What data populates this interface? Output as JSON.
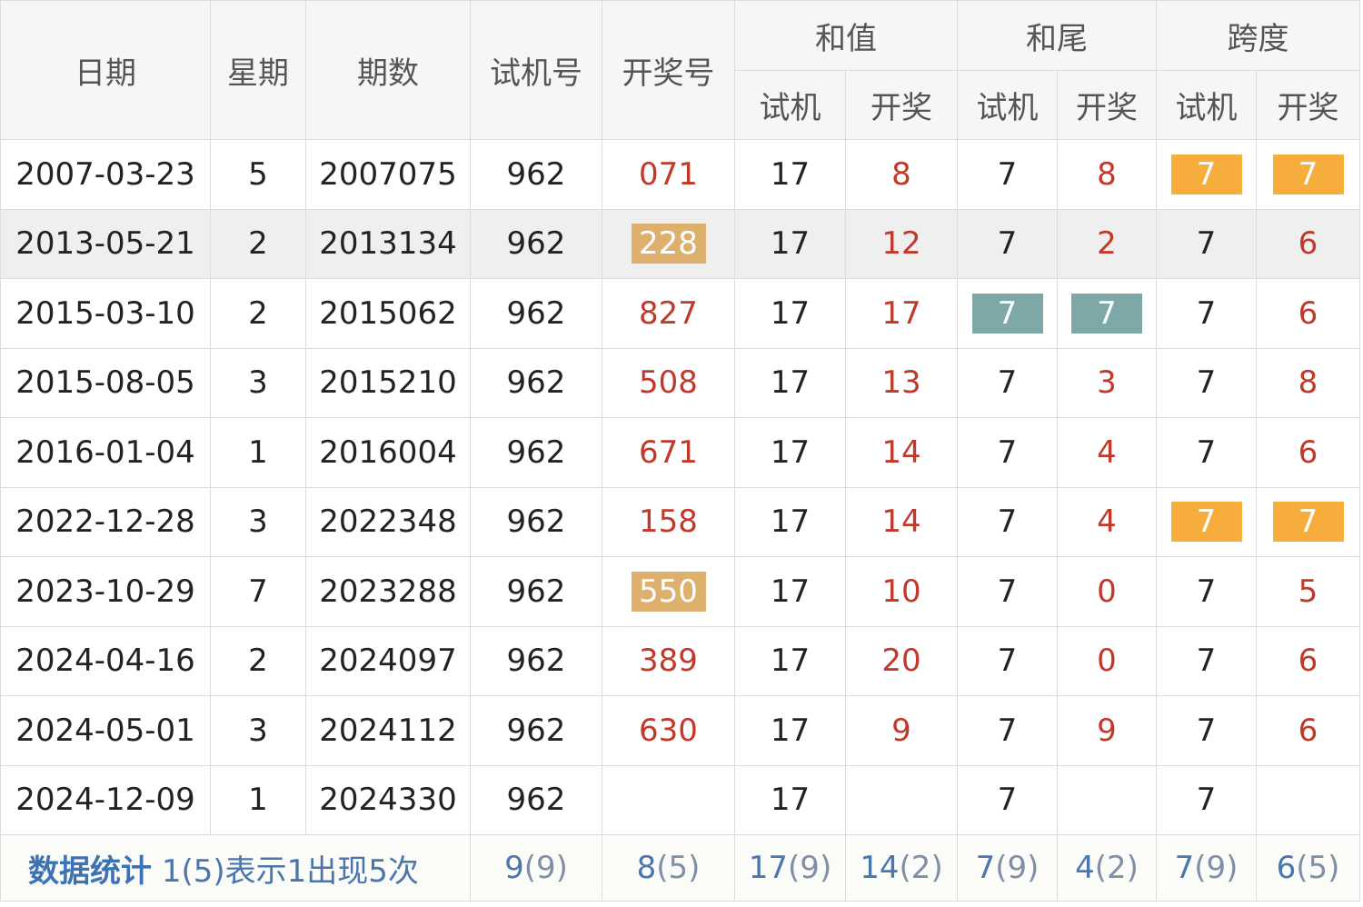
{
  "header": {
    "date": "日期",
    "weekday": "星期",
    "issue": "期数",
    "test_number": "试机号",
    "draw_number": "开奖号",
    "sum_group": "和值",
    "tail_group": "和尾",
    "span_group": "跨度",
    "sub_test": "试机",
    "sub_draw": "开奖"
  },
  "rows": [
    {
      "date": "2007-03-23",
      "weekday": "5",
      "issue": "2007075",
      "test": "962",
      "draw": "071",
      "sum_test": "17",
      "sum_draw": "8",
      "tail_test": "7",
      "tail_draw": "8",
      "span_test": "7",
      "span_draw": "7"
    },
    {
      "date": "2013-05-21",
      "weekday": "2",
      "issue": "2013134",
      "test": "962",
      "draw": "228",
      "sum_test": "17",
      "sum_draw": "12",
      "tail_test": "7",
      "tail_draw": "2",
      "span_test": "7",
      "span_draw": "6"
    },
    {
      "date": "2015-03-10",
      "weekday": "2",
      "issue": "2015062",
      "test": "962",
      "draw": "827",
      "sum_test": "17",
      "sum_draw": "17",
      "tail_test": "7",
      "tail_draw": "7",
      "span_test": "7",
      "span_draw": "6"
    },
    {
      "date": "2015-08-05",
      "weekday": "3",
      "issue": "2015210",
      "test": "962",
      "draw": "508",
      "sum_test": "17",
      "sum_draw": "13",
      "tail_test": "7",
      "tail_draw": "3",
      "span_test": "7",
      "span_draw": "8"
    },
    {
      "date": "2016-01-04",
      "weekday": "1",
      "issue": "2016004",
      "test": "962",
      "draw": "671",
      "sum_test": "17",
      "sum_draw": "14",
      "tail_test": "7",
      "tail_draw": "4",
      "span_test": "7",
      "span_draw": "6"
    },
    {
      "date": "2022-12-28",
      "weekday": "3",
      "issue": "2022348",
      "test": "962",
      "draw": "158",
      "sum_test": "17",
      "sum_draw": "14",
      "tail_test": "7",
      "tail_draw": "4",
      "span_test": "7",
      "span_draw": "7"
    },
    {
      "date": "2023-10-29",
      "weekday": "7",
      "issue": "2023288",
      "test": "962",
      "draw": "550",
      "sum_test": "17",
      "sum_draw": "10",
      "tail_test": "7",
      "tail_draw": "0",
      "span_test": "7",
      "span_draw": "5"
    },
    {
      "date": "2024-04-16",
      "weekday": "2",
      "issue": "2024097",
      "test": "962",
      "draw": "389",
      "sum_test": "17",
      "sum_draw": "20",
      "tail_test": "7",
      "tail_draw": "0",
      "span_test": "7",
      "span_draw": "6"
    },
    {
      "date": "2024-05-01",
      "weekday": "3",
      "issue": "2024112",
      "test": "962",
      "draw": "630",
      "sum_test": "17",
      "sum_draw": "9",
      "tail_test": "7",
      "tail_draw": "9",
      "span_test": "7",
      "span_draw": "6"
    },
    {
      "date": "2024-12-09",
      "weekday": "1",
      "issue": "2024330",
      "test": "962",
      "draw": "",
      "sum_test": "17",
      "sum_draw": "",
      "tail_test": "7",
      "tail_draw": "",
      "span_test": "7",
      "span_draw": ""
    }
  ],
  "footer": {
    "title": "数据统计",
    "desc": "1(5)表示1出现5次",
    "test_num": "9",
    "test_cnt": "(9)",
    "draw_num": "8",
    "draw_cnt": "(5)",
    "sum_test_num": "17",
    "sum_test_cnt": "(9)",
    "sum_draw_num": "14",
    "sum_draw_cnt": "(2)",
    "tail_test_num": "7",
    "tail_test_cnt": "(9)",
    "tail_draw_num": "4",
    "tail_draw_cnt": "(2)",
    "span_test_num": "7",
    "span_test_cnt": "(9)",
    "span_draw_num": "6",
    "span_draw_cnt": "(5)"
  },
  "colors": {
    "draw_red": "#c0392b",
    "highlight_tan": "#ddb06e",
    "highlight_orange": "#f6ad3c",
    "highlight_teal": "#7ea8a8",
    "footer_blue": "#3d73b4"
  }
}
